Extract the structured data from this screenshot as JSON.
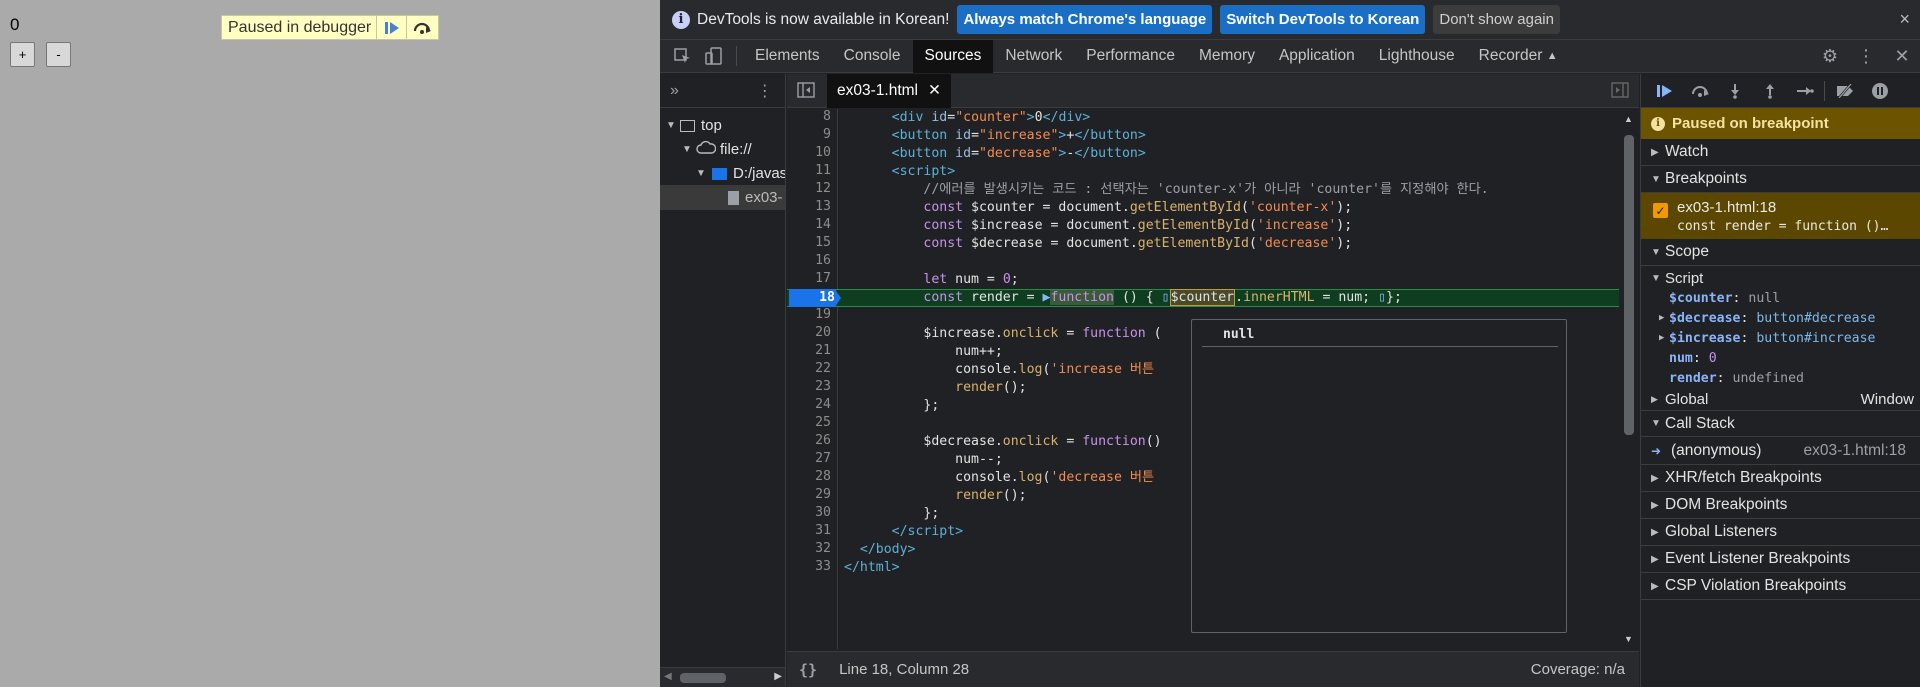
{
  "page": {
    "counter_value": "0",
    "increase_label": "+",
    "decrease_label": "-",
    "paused_text": "Paused in debugger"
  },
  "infobar": {
    "message": "DevTools is now available in Korean!",
    "btn_match": "Always match Chrome's language",
    "btn_switch": "Switch DevTools to Korean",
    "btn_dont_show": "Don't show again",
    "close": "×"
  },
  "tabs": [
    "Elements",
    "Console",
    "Sources",
    "Network",
    "Performance",
    "Memory",
    "Application",
    "Lighthouse",
    "Recorder"
  ],
  "active_tab": "Sources",
  "navigator": {
    "top": "top",
    "origin": "file://",
    "folder": "D:/javas",
    "file": "ex03-"
  },
  "editor": {
    "file_tab": "ex03-1.html",
    "status_position": "Line 18, Column 28",
    "coverage": "Coverage: n/a",
    "tooltip_value": "null"
  },
  "sidebar": {
    "paused_banner": "Paused on breakpoint",
    "watch": "Watch",
    "breakpoints": "Breakpoints",
    "bp_file": "ex03-1.html:18",
    "bp_code": "const render = function ()…",
    "scope": "Scope",
    "script": "Script",
    "scope_vars": [
      {
        "name": "$counter",
        "value": "null",
        "type": "null",
        "expandable": false
      },
      {
        "name": "$decrease",
        "value": "button#decrease",
        "type": "obj",
        "expandable": true
      },
      {
        "name": "$increase",
        "value": "button#increase",
        "type": "obj",
        "expandable": true
      },
      {
        "name": "num",
        "value": "0",
        "type": "num",
        "expandable": false
      },
      {
        "name": "render",
        "value": "undefined",
        "type": "null",
        "expandable": false
      }
    ],
    "global": "Global",
    "global_value": "Window",
    "call_stack": "Call Stack",
    "frame_name": "(anonymous)",
    "frame_loc": "ex03-1.html:18",
    "xhr": "XHR/fetch Breakpoints",
    "dom": "DOM Breakpoints",
    "global_listeners": "Global Listeners",
    "event_listener": "Event Listener Breakpoints",
    "csp": "CSP Violation Breakpoints"
  },
  "line_numbers": [
    "8",
    "9",
    "10",
    "11",
    "12",
    "13",
    "14",
    "15",
    "16",
    "17",
    "18",
    "19",
    "20",
    "21",
    "22",
    "23",
    "24",
    "25",
    "26",
    "27",
    "28",
    "29",
    "30",
    "31",
    "32",
    "33"
  ]
}
